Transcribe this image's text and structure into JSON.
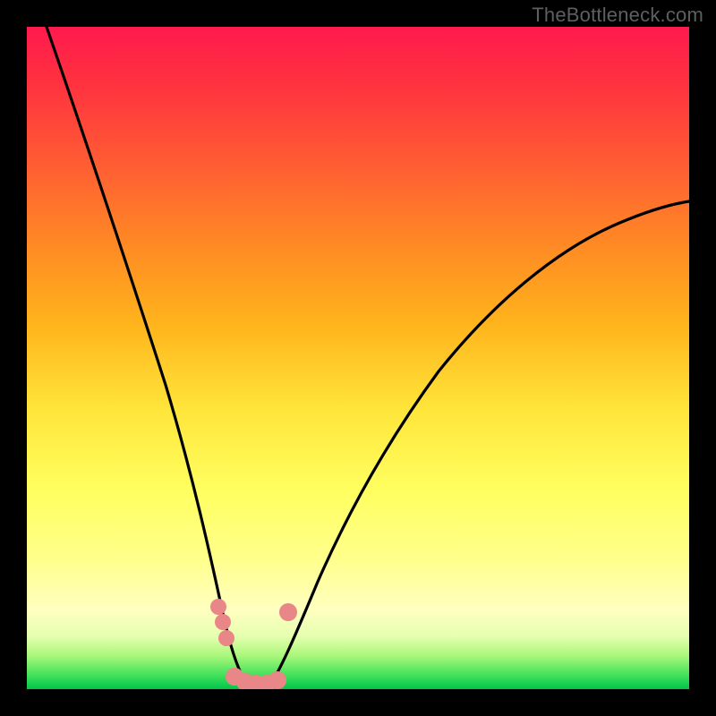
{
  "watermark": "TheBottleneck.com",
  "chart_data": {
    "type": "line",
    "title": "",
    "xlabel": "",
    "ylabel": "",
    "xlim": [
      0,
      100
    ],
    "ylim": [
      0,
      100
    ],
    "grid": false,
    "legend": false,
    "series": [
      {
        "name": "left-curve",
        "x": [
          3,
          6,
          9,
          12,
          15,
          18,
          20,
          22,
          24,
          26,
          28,
          29,
          30,
          31,
          32,
          33
        ],
        "y": [
          100,
          88,
          76,
          64,
          53,
          42,
          35,
          28,
          22,
          16,
          11,
          8,
          5.5,
          3.5,
          2,
          1
        ]
      },
      {
        "name": "right-curve",
        "x": [
          37,
          38,
          40,
          43,
          46,
          50,
          55,
          60,
          65,
          70,
          75,
          80,
          85,
          90,
          95,
          100
        ],
        "y": [
          1,
          2,
          5,
          10,
          15,
          21,
          28,
          35,
          41,
          47,
          52,
          57,
          61,
          65,
          68.5,
          72
        ]
      },
      {
        "name": "floor-pink-dots-left",
        "x": [
          29,
          30,
          30.5
        ],
        "y": [
          13,
          10,
          8
        ]
      },
      {
        "name": "floor-pink-dots-center",
        "x": [
          31,
          32,
          33,
          34,
          35,
          36
        ],
        "y": [
          2,
          1.5,
          1.5,
          1.5,
          1.5,
          2
        ]
      },
      {
        "name": "floor-pink-dot-right",
        "x": [
          38
        ],
        "y": [
          12.5
        ]
      }
    ],
    "colors": {
      "curve": "#000000",
      "dots": "#e98688",
      "gradient_top": "#ff1a4d",
      "gradient_bottom": "#00c44a"
    }
  }
}
